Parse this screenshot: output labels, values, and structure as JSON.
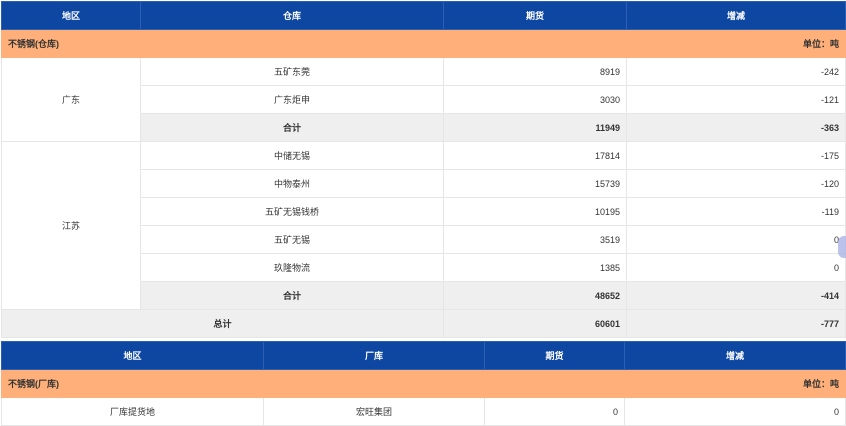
{
  "warehouse_table": {
    "headers": [
      "地区",
      "仓库",
      "期货",
      "增减"
    ],
    "section_title": "不锈钢(仓库)",
    "unit": "单位：吨",
    "regions": [
      {
        "name": "广东",
        "rows": [
          {
            "warehouse": "五矿东莞",
            "futures": "8919",
            "change": "-242"
          },
          {
            "warehouse": "广东炬申",
            "futures": "3030",
            "change": "-121"
          }
        ],
        "subtotal": {
          "label": "合计",
          "futures": "11949",
          "change": "-363"
        }
      },
      {
        "name": "江苏",
        "rows": [
          {
            "warehouse": "中储无锡",
            "futures": "17814",
            "change": "-175"
          },
          {
            "warehouse": "中物泰州",
            "futures": "15739",
            "change": "-120"
          },
          {
            "warehouse": "五矿无锡钱桥",
            "futures": "10195",
            "change": "-119"
          },
          {
            "warehouse": "五矿无锡",
            "futures": "3519",
            "change": "0"
          },
          {
            "warehouse": "玖隆物流",
            "futures": "1385",
            "change": "0"
          }
        ],
        "subtotal": {
          "label": "合计",
          "futures": "48652",
          "change": "-414"
        }
      }
    ],
    "total": {
      "label": "总计",
      "futures": "60601",
      "change": "-777"
    }
  },
  "factory_table": {
    "headers": [
      "地区",
      "厂库",
      "期货",
      "增减"
    ],
    "section_title": "不锈钢(厂库)",
    "unit": "单位：吨",
    "rows": [
      {
        "region": "厂库提货地",
        "factory": "宏旺集团",
        "futures": "0",
        "change": "0"
      }
    ]
  }
}
